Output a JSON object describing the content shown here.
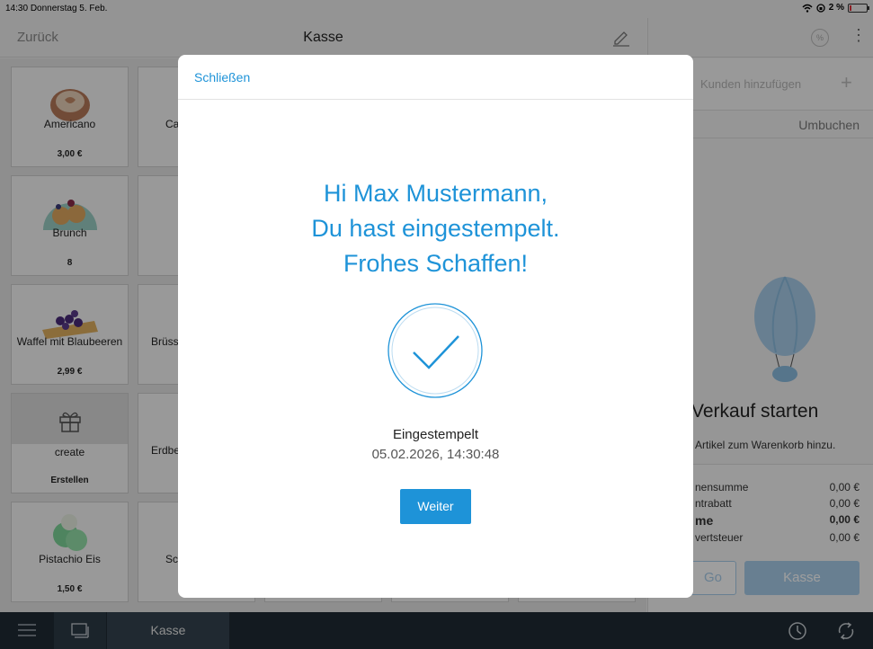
{
  "status_bar": {
    "time": "14:30",
    "date": "Donnerstag 5. Feb.",
    "battery": "2 %"
  },
  "header": {
    "back_label": "Zurück",
    "title": "Kasse"
  },
  "tiles": [
    {
      "name": "Americano",
      "price": "3,00 €"
    },
    {
      "name": "Brunch",
      "price": "8"
    },
    {
      "name": "Waffel mit Blaubeeren",
      "price": "2,99 €"
    },
    {
      "name": "create",
      "price": "Erstellen"
    },
    {
      "name": "Pistachio Eis",
      "price": "1,50 €"
    }
  ],
  "partial_tiles": [
    "Ca",
    "",
    "Brüss",
    "Erdbe",
    "Sc"
  ],
  "right_panel": {
    "percent_icon_label": "%",
    "add_customer_label": "Kunden hinzufügen",
    "rebook_label": "Umbuchen",
    "empty_title": "Verkauf starten",
    "empty_subtitle": "Artikel zum Warenkorb hinzu.",
    "summary": [
      {
        "label": "nensumme",
        "value": "0,00 €"
      },
      {
        "label": "ntrabatt",
        "value": "0,00 €"
      },
      {
        "label": "me",
        "value": "0,00 €"
      },
      {
        "label": "vertsteuer",
        "value": "0,00 €"
      }
    ],
    "go_label": "Go",
    "checkout_label": "Kasse"
  },
  "bottom_bar": {
    "active_tab": "Kasse"
  },
  "modal": {
    "close_label": "Schließen",
    "greeting_line1": "Hi Max Mustermann,",
    "greeting_line2": "Du hast eingestempelt.",
    "greeting_line3": "Frohes Schaffen!",
    "status": "Eingestempelt",
    "timestamp": "05.02.2026, 14:30:48",
    "continue_label": "Weiter"
  },
  "colors": {
    "accent": "#1e93d8",
    "bottom_bar": "#1f2a34"
  }
}
